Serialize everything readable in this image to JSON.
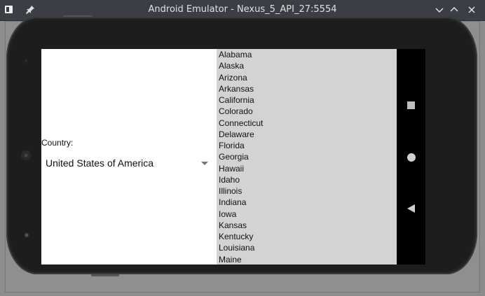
{
  "window": {
    "title": "Android Emulator - Nexus_5_API_27:5554"
  },
  "form": {
    "country_label": "Country:",
    "country_selected": "United States of America"
  },
  "states": [
    "Alabama",
    "Alaska",
    "Arizona",
    "Arkansas",
    "California",
    "Colorado",
    "Connecticut",
    "Delaware",
    "Florida",
    "Georgia",
    "Hawaii",
    "Idaho",
    "Illinois",
    "Indiana",
    "Iowa",
    "Kansas",
    "Kentucky",
    "Louisiana",
    "Maine"
  ],
  "icons": {
    "app": "emulator-app-icon",
    "pin": "pin-icon",
    "minimize": "chevron-down-icon",
    "maximize": "chevron-up-icon",
    "close": "close-icon",
    "spinner": "dropdown-arrow-icon",
    "recent": "recent-apps-icon",
    "home": "home-icon",
    "back": "back-icon"
  },
  "colors": {
    "titlebar": "#3b3f45",
    "list_background": "#d3d3d3",
    "screen_background": "#ffffff",
    "phone_body": "#1d1d1d"
  }
}
